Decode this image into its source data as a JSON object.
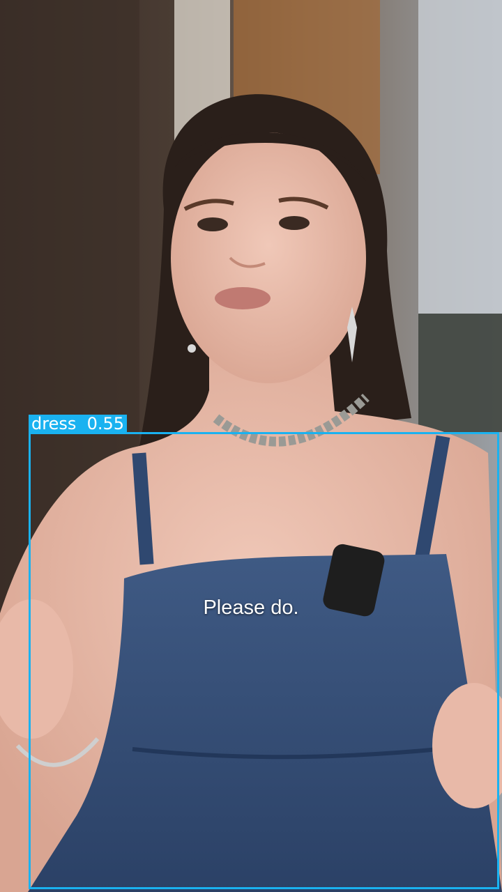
{
  "detection": {
    "label": "dress  0.55",
    "class_name": "dress",
    "confidence": 0.55,
    "color": "#1ab2f0"
  },
  "subtitle": {
    "text": "Please do."
  },
  "scene": {
    "subject": "woman-in-denim-dress",
    "accessories": [
      "silver-choker-icon",
      "drop-earring-icon",
      "clip-microphone-icon",
      "bangle-icon"
    ]
  }
}
